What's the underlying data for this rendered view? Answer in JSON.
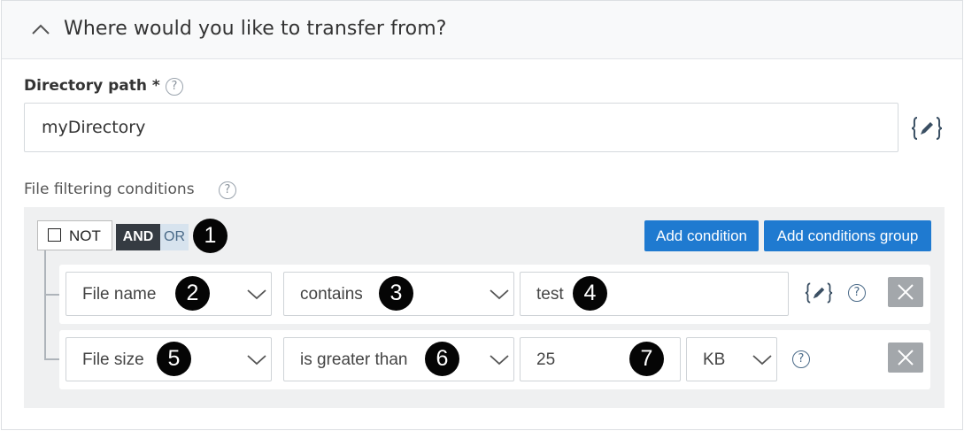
{
  "header": {
    "title": "Where would you like to transfer from?"
  },
  "directory": {
    "label": "Directory path *",
    "help": "?",
    "value": "myDirectory"
  },
  "filtering": {
    "label": "File filtering conditions",
    "help": "?",
    "not_label": "NOT",
    "and_label": "AND",
    "or_label": "OR",
    "add_condition_label": "Add condition",
    "add_group_label": "Add conditions group",
    "conditions": [
      {
        "field": "File name",
        "operator": "contains",
        "value": "test"
      },
      {
        "field": "File size",
        "operator": "is greater than",
        "value": "25",
        "unit": "KB"
      }
    ]
  },
  "badges": [
    "1",
    "2",
    "3",
    "4",
    "5",
    "6",
    "7"
  ],
  "icons": {
    "collapse": "chevron-up-icon",
    "variable": "curly-brace-pencil-icon",
    "help": "question-circle-icon",
    "delete": "close-icon",
    "dropdown": "chevron-down-icon"
  },
  "colors": {
    "accent": "#1f7ad0",
    "and_bg": "#353b42",
    "or_bg": "#d7e3ee",
    "delete_bg": "#a3a7ab"
  }
}
